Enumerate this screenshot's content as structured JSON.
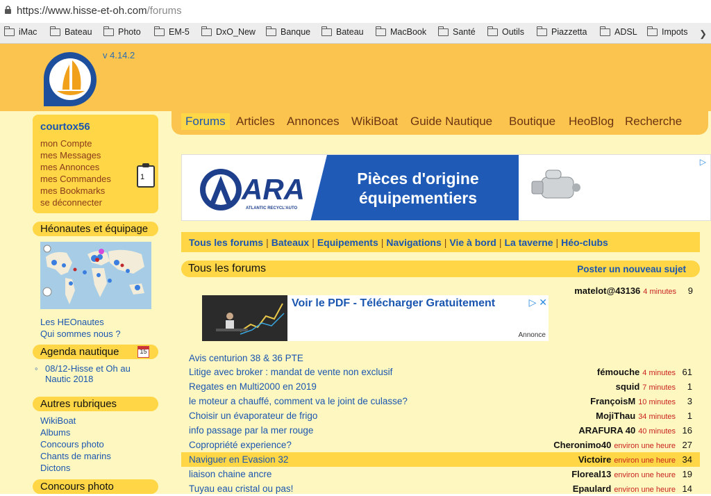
{
  "browser": {
    "url_host": "https://www.hisse-et-oh.com",
    "url_path": "/forums",
    "bookmarks": [
      "iMac",
      "Bateau",
      "Photo",
      "EM-5",
      "DxO_New",
      "Banque",
      "Bateau",
      "MacBook",
      "Santé",
      "Outils",
      "Piazzetta",
      "ADSL",
      "Impots"
    ]
  },
  "header": {
    "version": "v 4.14.2"
  },
  "user": {
    "name": "courtox56",
    "links": [
      "mon Compte",
      "mes Messages",
      "mes Annonces",
      "mes Commandes",
      "mes Bookmarks",
      "se déconnecter"
    ],
    "clipboard_count": "1"
  },
  "sidebar": {
    "heonautes_title": "Héonautes et équipage",
    "heonautes_links": [
      "Les HEOnautes",
      "Qui sommes nous ?"
    ],
    "agenda_title": "Agenda nautique",
    "agenda_icon_day": "15",
    "agenda_item": "08/12-Hisse et Oh au Nautic 2018",
    "autres_title": "Autres rubriques",
    "autres_links": [
      "WikiBoat",
      "Albums",
      "Concours photo",
      "Chants de marins",
      "Dictons"
    ],
    "concours_title": "Concours photo"
  },
  "nav": {
    "tabs": [
      "Forums",
      "Articles",
      "Annonces",
      "WikiBoat",
      "Guide Nautique",
      "Boutique",
      "HeoBlog",
      "Recherche"
    ],
    "active": "Forums"
  },
  "ad_banner": {
    "brand": "ARA",
    "brand_sub": "ATLANTIC RECYCL'AUTO",
    "headline_1": "Pièces d'origine",
    "headline_2": "équipementiers"
  },
  "forum_nav": [
    "Tous les forums",
    "Bateaux",
    "Equipements",
    "Navigations",
    "Vie à bord",
    "La taverne",
    "Héo-clubs"
  ],
  "forum": {
    "title": "Tous les forums",
    "post_link": "Poster un nouveau sujet"
  },
  "ad_inline": {
    "cta": "Voir le PDF - Télécharger Gratuitement",
    "label": "Annonce"
  },
  "first_stat": {
    "user": "matelot@43136",
    "time": "4 minutes",
    "count": "9"
  },
  "topics": [
    {
      "title": "Avis centurion 38 & 36 PTE",
      "user": "",
      "time": "",
      "count": ""
    },
    {
      "title": "Litige avec broker : mandat de vente non exclusif",
      "user": "fémouche",
      "time": "4 minutes",
      "count": "61"
    },
    {
      "title": "Regates en Multi2000 en 2019",
      "user": "squid",
      "time": "7 minutes",
      "count": "1"
    },
    {
      "title": "le moteur a chauffé, comment va le joint de culasse?",
      "user": "FrançoisM",
      "time": "10 minutes",
      "count": "3"
    },
    {
      "title": "Choisir un évaporateur de frigo",
      "user": "MojiThau",
      "time": "34 minutes",
      "count": "1"
    },
    {
      "title": "info passage par la mer rouge",
      "user": "ARAFURA 40",
      "time": "40 minutes",
      "count": "16"
    },
    {
      "title": "Copropriété experience?",
      "user": "Cheronimo40",
      "time": "environ une heure",
      "count": "27"
    },
    {
      "title": "Naviguer en Evasion 32",
      "user": "Victoire",
      "time": "environ une heure",
      "count": "34"
    },
    {
      "title": "liaison chaine ancre",
      "user": "Floreal13",
      "time": "environ une heure",
      "count": "19"
    },
    {
      "title": "Tuyau eau cristal ou pas!",
      "user": "Epaulard",
      "time": "environ une heure",
      "count": "14"
    }
  ]
}
